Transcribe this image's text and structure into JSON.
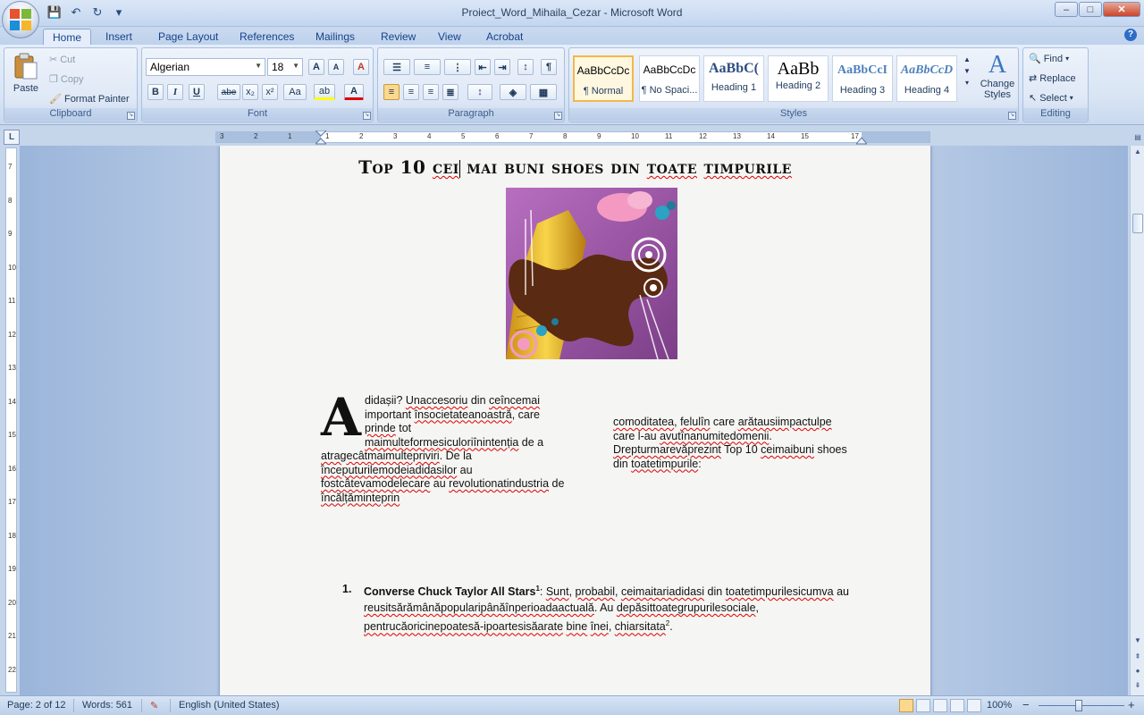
{
  "window": {
    "title": "Proiect_Word_Mihaila_Cezar - Microsoft Word",
    "controls": {
      "minimize": "–",
      "maximize": "□",
      "close": "✕"
    }
  },
  "qat": {
    "save_icon": "💾",
    "undo_icon": "↶",
    "redo_icon": "↻",
    "dropdown": "▾"
  },
  "tabs": [
    "Home",
    "Insert",
    "Page Layout",
    "References",
    "Mailings",
    "Review",
    "View",
    "Acrobat"
  ],
  "help_label": "?",
  "ribbon": {
    "clipboard": {
      "label": "Clipboard",
      "paste": "Paste",
      "cut": "Cut",
      "copy": "Copy",
      "format_painter": "Format Painter"
    },
    "font": {
      "label": "Font",
      "font_name": "Algerian",
      "font_size": "18",
      "grow": "A",
      "shrink": "A",
      "clear": "A",
      "bold": "B",
      "italic": "I",
      "underline": "U",
      "strike": "abe",
      "subscript": "x₂",
      "superscript": "x²",
      "change_case": "Aa",
      "highlight": "ab",
      "font_color": "A"
    },
    "paragraph": {
      "label": "Paragraph",
      "pilcrow": "¶"
    },
    "styles": {
      "label": "Styles",
      "items": [
        {
          "sample": "AaBbCcDc",
          "name": "¶ Normal"
        },
        {
          "sample": "AaBbCcDc",
          "name": "¶ No Spaci..."
        },
        {
          "sample": "AaBbC(",
          "name": "Heading 1"
        },
        {
          "sample": "AaBb",
          "name": "Heading 2"
        },
        {
          "sample": "AaBbCcI",
          "name": "Heading 3"
        },
        {
          "sample": "AaBbCcD",
          "name": "Heading 4"
        }
      ],
      "change_styles": "Change Styles"
    },
    "editing": {
      "label": "Editing",
      "find": "Find",
      "replace": "Replace",
      "select": "Select"
    }
  },
  "ruler": {
    "corner": "L",
    "h_labels": [
      "3",
      "2",
      "1",
      "1",
      "2",
      "3",
      "4",
      "5",
      "6",
      "7",
      "8",
      "9",
      "10",
      "11",
      "12",
      "13",
      "14",
      "15",
      "17"
    ],
    "v_labels": [
      "7",
      "8",
      "9",
      "10",
      "11",
      "12",
      "13",
      "14",
      "15",
      "16",
      "17",
      "18",
      "19",
      "20",
      "21",
      "22"
    ]
  },
  "document": {
    "title_parts": [
      "Top 10 ",
      "cei",
      " mai buni shoes din ",
      "toate",
      " ",
      "timpurile"
    ],
    "drop_cap": "A",
    "col1": [
      {
        "t": "didașii? ",
        "s": false
      },
      {
        "t": "Unaccesoriu",
        "s": true
      },
      {
        "t": " din ",
        "s": false
      },
      {
        "t": "ceîncemai",
        "s": true
      },
      {
        "t": " important ",
        "s": false
      },
      {
        "t": "însocietateanoastră",
        "s": true
      },
      {
        "t": ", care ",
        "s": false
      },
      {
        "t": "prinde",
        "s": true
      },
      {
        "t": " tot ",
        "s": false
      },
      {
        "t": "maimulteformesiculoriînintenția",
        "s": true
      },
      {
        "t": " de a ",
        "s": false
      },
      {
        "t": "atragecâtmaimultepriviri",
        "s": true
      },
      {
        "t": ". De la ",
        "s": false
      },
      {
        "t": "începuturilemodeiadidasilor",
        "s": true
      },
      {
        "t": " au ",
        "s": false
      },
      {
        "t": "fostcâtevamodelecare",
        "s": true
      },
      {
        "t": " au ",
        "s": false
      },
      {
        "t": "revolutionatindustria",
        "s": true
      },
      {
        "t": " de ",
        "s": false
      },
      {
        "t": "încălțăminteprin",
        "s": true
      }
    ],
    "col2": [
      {
        "t": "comoditatea",
        "s": true
      },
      {
        "t": ", ",
        "s": false
      },
      {
        "t": "felulîn",
        "s": true
      },
      {
        "t": " care ",
        "s": false
      },
      {
        "t": "arătausiimpactulpe",
        "s": true
      },
      {
        "t": " care l-au ",
        "s": false
      },
      {
        "t": "avutînanumitedomenii",
        "s": true
      },
      {
        "t": ". ",
        "s": false
      },
      {
        "t": "Drepturmarevăprezint",
        "s": true
      },
      {
        "t": " Top 10 ",
        "s": false
      },
      {
        "t": "ceimaibuni",
        "s": true
      },
      {
        "t": " shoes din ",
        "s": false
      },
      {
        "t": "toatetimpurile",
        "s": true
      },
      {
        "t": ":",
        "s": false
      }
    ],
    "list_num": "1.",
    "list_title": "Converse Chuck Taylor All Stars",
    "list_sup": "1",
    "list_body": [
      {
        "t": ": ",
        "s": false
      },
      {
        "t": "Sunt",
        "s": true
      },
      {
        "t": ", ",
        "s": false
      },
      {
        "t": "probabil",
        "s": true
      },
      {
        "t": ", ",
        "s": false
      },
      {
        "t": "ceimaitariadidasi",
        "s": true
      },
      {
        "t": " din ",
        "s": false
      },
      {
        "t": "toatetimpurilesicumva",
        "s": true
      },
      {
        "t": " au ",
        "s": false
      },
      {
        "t": "reusitsărămânăpopularipânăînperioadaactuală",
        "s": true
      },
      {
        "t": ". Au ",
        "s": false
      },
      {
        "t": "depăsittoategrupurilesociale",
        "s": true
      },
      {
        "t": ", ",
        "s": false
      },
      {
        "t": "pentrucăoricinepoatesă-ipoartesisăarate",
        "s": true
      },
      {
        "t": " ",
        "s": false
      },
      {
        "t": "bine",
        "s": true
      },
      {
        "t": " ",
        "s": false
      },
      {
        "t": "înei",
        "s": true
      },
      {
        "t": ", ",
        "s": false
      },
      {
        "t": "chiarsitata",
        "s": true
      }
    ],
    "list_sup2": "2",
    "list_end": "."
  },
  "statusbar": {
    "page": "Page: 2 of 12",
    "words": "Words: 561",
    "language": "English (United States)",
    "zoom": "100%",
    "zoom_minus": "−",
    "zoom_plus": "+"
  },
  "colors": {
    "accent": "#15428b",
    "ribbon": "#dbe6f5",
    "squiggle": "#dd0000"
  }
}
